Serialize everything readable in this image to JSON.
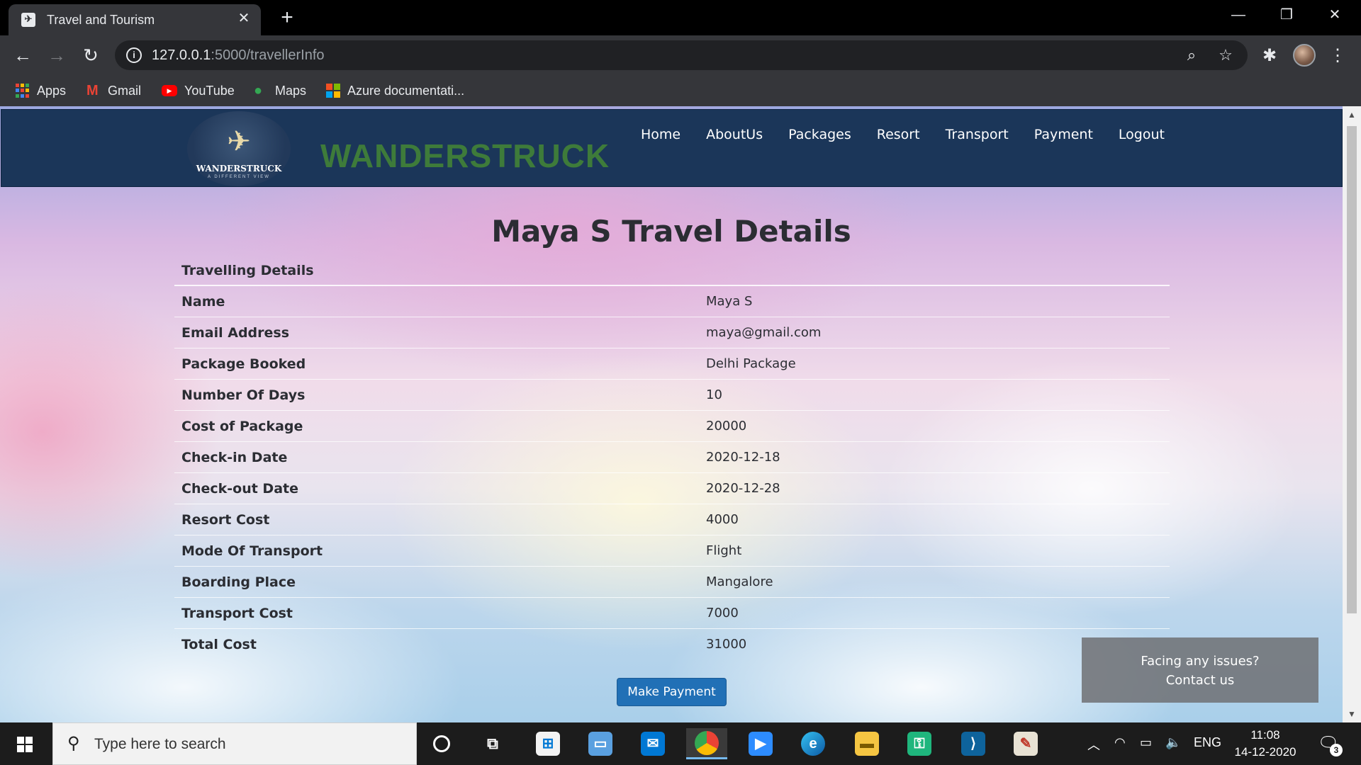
{
  "browser": {
    "tab_title": "Travel and Tourism",
    "tab_close": "✕",
    "new_tab": "+",
    "window_controls": {
      "minimize": "—",
      "restore": "❐",
      "close": "✕"
    },
    "url_host": "127.0.0.1",
    "url_path": ":5000/travellerInfo",
    "bookmarks": [
      "Apps",
      "Gmail",
      "YouTube",
      "Maps",
      "Azure documentati..."
    ]
  },
  "site": {
    "logo_text": "WANDERSTRUCK",
    "logo_subtext": "A DIFFERENT VIEW",
    "brand": "WANDERSTRUCK",
    "nav": [
      "Home",
      "AboutUs",
      "Packages",
      "Resort",
      "Transport",
      "Payment",
      "Logout"
    ]
  },
  "main": {
    "title": "Maya S Travel Details",
    "section_heading": "Travelling Details",
    "rows": [
      {
        "label": "Name",
        "value": "Maya S"
      },
      {
        "label": "Email Address",
        "value": "maya@gmail.com"
      },
      {
        "label": "Package Booked",
        "value": "Delhi Package"
      },
      {
        "label": "Number Of Days",
        "value": "10"
      },
      {
        "label": "Cost of Package",
        "value": "20000"
      },
      {
        "label": "Check-in Date",
        "value": "2020-12-18"
      },
      {
        "label": "Check-out Date",
        "value": "2020-12-28"
      },
      {
        "label": "Resort Cost",
        "value": "4000"
      },
      {
        "label": "Mode Of Transport",
        "value": "Flight"
      },
      {
        "label": "Boarding Place",
        "value": "Mangalore"
      },
      {
        "label": "Transport Cost",
        "value": "7000"
      },
      {
        "label": "Total Cost",
        "value": "31000"
      }
    ],
    "pay_button": "Make Payment",
    "contact_line1": "Facing any issues?",
    "contact_line2": "Contact us"
  },
  "taskbar": {
    "search_placeholder": "Type here to search",
    "language": "ENG",
    "time": "11:08",
    "date": "14-12-2020",
    "notification_count": "3"
  },
  "colors": {
    "header_bg": "#1b3659",
    "brand_green": "#3e7b3a",
    "button_blue": "#2170b6"
  }
}
